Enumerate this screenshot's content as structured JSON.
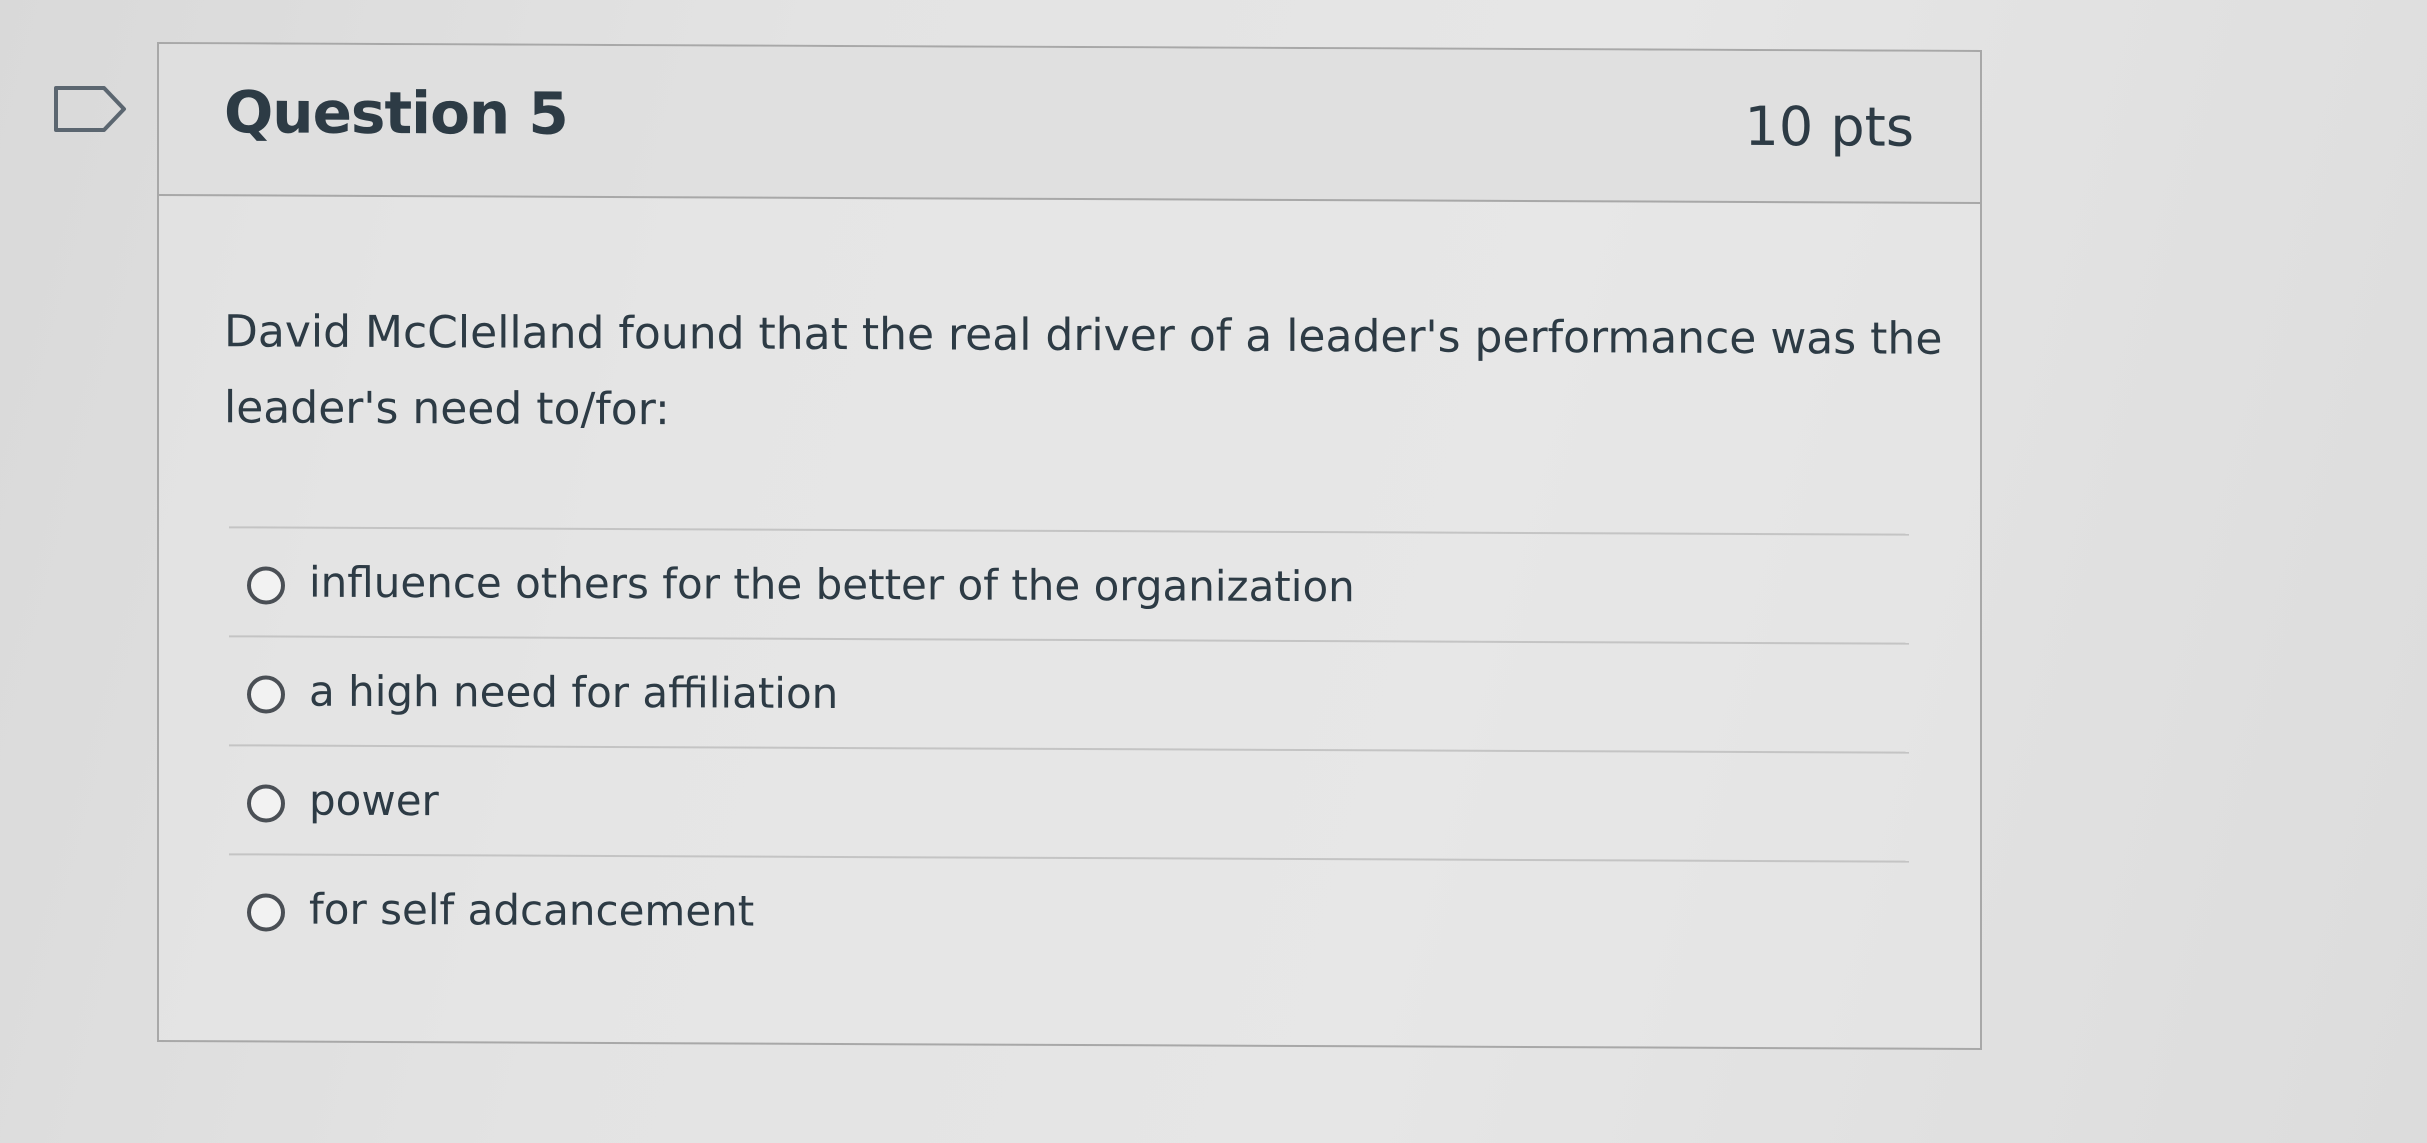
{
  "question": {
    "title": "Question 5",
    "points": "10 pts",
    "text": "David McClelland found that the real driver of a leader's performance was the leader's need to/for:",
    "flag_icon": "flag-bookmark-icon"
  },
  "answers": [
    {
      "label": "influence others for the better of the organization",
      "selected": false
    },
    {
      "label": "a high need for affiliation",
      "selected": false
    },
    {
      "label": "power",
      "selected": false
    },
    {
      "label": "for self adcancement",
      "selected": false
    }
  ],
  "colors": {
    "text": "#2d3b45",
    "border": "#a8a8a8",
    "divider": "#c4c4c4",
    "radio_ring": "#4a4f55"
  }
}
